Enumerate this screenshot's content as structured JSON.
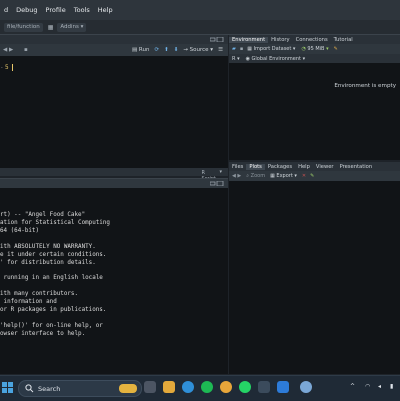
{
  "menubar": {
    "items": [
      "d",
      "Debug",
      "Profile",
      "Tools",
      "Help"
    ]
  },
  "toolbar": {
    "file_label": "file/function",
    "addins_label": "Addins"
  },
  "source": {
    "buttons": {
      "run": "Run",
      "source": "Source"
    },
    "editor_line": "5",
    "status": "R Script"
  },
  "console": {
    "lines": [
      "rt) -- \"Angel Food Cake\"",
      "ation for Statistical Computing",
      "64 (64-bit)",
      "",
      "ith ABSOLUTELY NO WARRANTY.",
      "e it under certain conditions.",
      "' for distribution details.",
      "",
      " running in an English locale",
      "",
      "ith many contributors.",
      " information and",
      "or R packages in publications.",
      "",
      "'help()' for on-line help, or",
      "owser interface to help."
    ]
  },
  "environment": {
    "tabs": [
      "Environment",
      "History",
      "Connections",
      "Tutorial"
    ],
    "active_tab": "Environment",
    "import_label": "Import Dataset",
    "memory_label": "95 MiB",
    "scope_label": "Global Environment",
    "empty_text": "Environment is empty"
  },
  "files": {
    "tabs": [
      "Files",
      "Plots",
      "Packages",
      "Help",
      "Viewer",
      "Presentation"
    ],
    "active_tab": "Plots",
    "zoom_label": "Zoom",
    "export_label": "Export"
  },
  "taskbar": {
    "search_placeholder": "Search"
  },
  "colors": {
    "accent": "#4aa3df",
    "editor_bg": "#111417",
    "pane_bg": "#2f373e"
  }
}
